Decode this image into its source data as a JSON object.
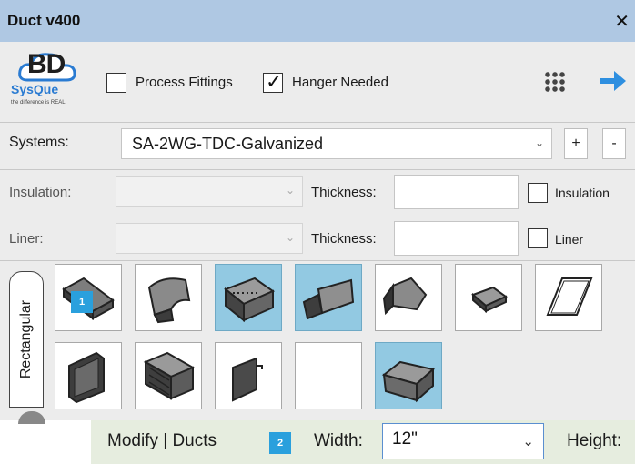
{
  "window": {
    "title": "Duct v400"
  },
  "logo": {
    "mark": "BD",
    "brand": "SysQue",
    "tagline": "the difference is REAL"
  },
  "toolbar": {
    "process_fittings": {
      "label": "Process Fittings",
      "checked": false
    },
    "hanger_needed": {
      "label": "Hanger Needed",
      "checked": true
    },
    "grid_icon": "grid-dots-icon",
    "arrow_icon": "arrow-right-icon"
  },
  "systems": {
    "label": "Systems:",
    "value": "SA-2WG-TDC-Galvanized",
    "add": "+",
    "remove": "-"
  },
  "insulation": {
    "label": "Insulation:",
    "value": "",
    "thickness_label": "Thickness:",
    "thickness_value": "",
    "checkbox_label": "Insulation",
    "checked": false
  },
  "liner": {
    "label": "Liner:",
    "value": "",
    "thickness_label": "Thickness:",
    "thickness_value": "",
    "checkbox_label": "Liner",
    "checked": false
  },
  "palette": {
    "tab_label": "Rectangular",
    "row1": [
      {
        "name": "straight-duct-icon",
        "selected": false
      },
      {
        "name": "elbow-icon",
        "selected": false
      },
      {
        "name": "perforated-box-icon",
        "selected": true
      },
      {
        "name": "offset-transition-icon",
        "selected": true
      },
      {
        "name": "round-transition-icon",
        "selected": false
      },
      {
        "name": "end-cap-icon",
        "selected": false
      },
      {
        "name": "access-panel-icon",
        "selected": false
      }
    ],
    "row2": [
      {
        "name": "flange-panel-icon",
        "selected": false
      },
      {
        "name": "lined-duct-icon",
        "selected": false
      },
      {
        "name": "damper-plate-icon",
        "selected": false
      },
      {
        "name": "empty-slot",
        "selected": false
      },
      {
        "name": "square-to-square-icon",
        "selected": true
      }
    ]
  },
  "callouts": {
    "one": "1",
    "two": "2"
  },
  "revit": {
    "context": "Modify | Ducts",
    "width_label": "Width:",
    "width_value": "12\"",
    "height_label": "Height:"
  },
  "colors": {
    "titlebar": "#afc8e3",
    "selected_tile": "#92c9e2",
    "callout": "#2aa0dd",
    "revit_bar": "#e6eddf",
    "arrow": "#2e8fe0"
  }
}
